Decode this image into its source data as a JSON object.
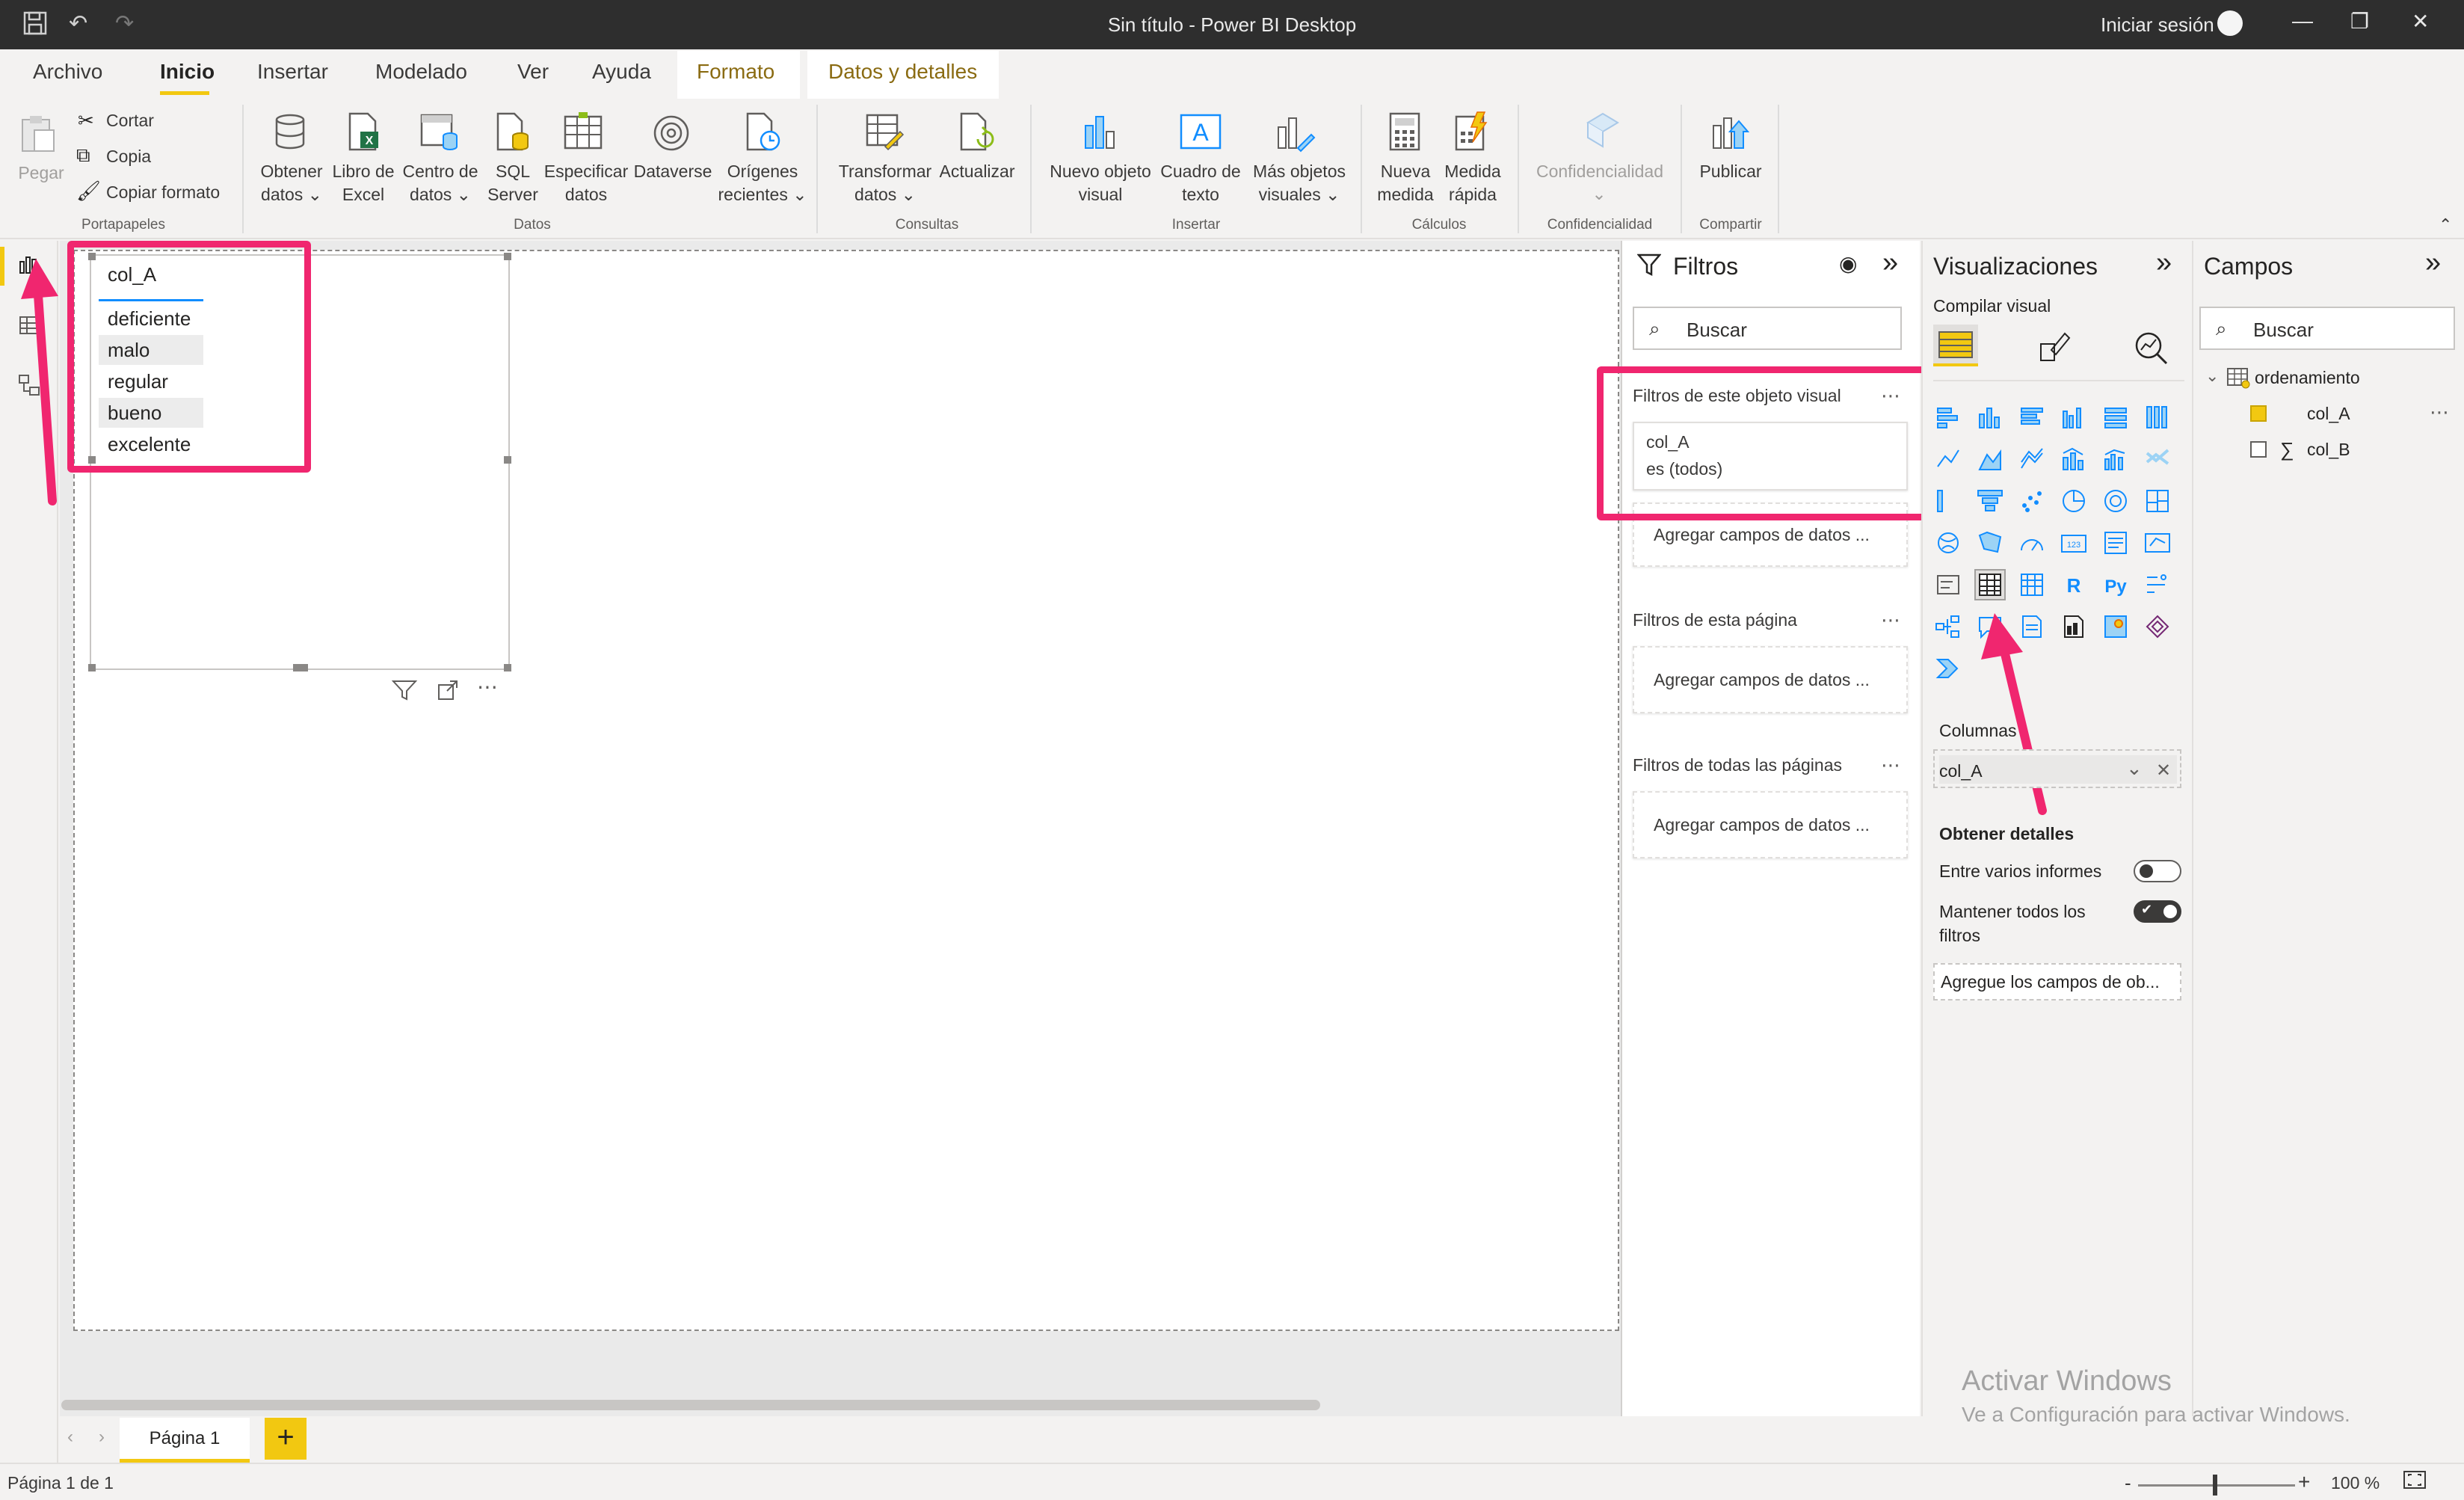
{
  "window": {
    "title": "Sin título - Power BI Desktop",
    "signin": "Iniciar sesión"
  },
  "menu": {
    "tabs": [
      "Archivo",
      "Inicio",
      "Insertar",
      "Modelado",
      "Ver",
      "Ayuda"
    ],
    "context_tabs": [
      "Formato",
      "Datos y detalles"
    ],
    "active": "Inicio"
  },
  "ribbon": {
    "portapapeles": {
      "paste": "Pegar",
      "cut": "Cortar",
      "copy": "Copia",
      "copy_format": "Copiar formato",
      "group": "Portapapeles"
    },
    "datos": {
      "get_data": [
        "Obtener",
        "datos"
      ],
      "excel": [
        "Libro de",
        "Excel"
      ],
      "datahub": [
        "Centro de",
        "datos"
      ],
      "sql": [
        "SQL",
        "Server"
      ],
      "enter_data": [
        "Especificar",
        "datos"
      ],
      "dataverse": "Dataverse",
      "recent": [
        "Orígenes",
        "recientes"
      ],
      "group": "Datos"
    },
    "consultas": {
      "transform": [
        "Transformar",
        "datos"
      ],
      "refresh": "Actualizar",
      "group": "Consultas"
    },
    "insertar": {
      "new_visual": [
        "Nuevo objeto",
        "visual"
      ],
      "textbox": [
        "Cuadro de",
        "texto"
      ],
      "more_visuals": [
        "Más objetos",
        "visuales"
      ],
      "group": "Insertar"
    },
    "calculos": {
      "new_measure": [
        "Nueva",
        "medida"
      ],
      "quick_measure": [
        "Medida",
        "rápida"
      ],
      "group": "Cálculos"
    },
    "confidencialidad": {
      "sensitivity": "Confidencialidad",
      "group": "Confidencialidad"
    },
    "compartir": {
      "publish": "Publicar",
      "group": "Compartir"
    }
  },
  "slicer": {
    "header": "col_A",
    "items": [
      "deficiente",
      "malo",
      "regular",
      "bueno",
      "excelente"
    ]
  },
  "filters": {
    "title": "Filtros",
    "search_placeholder": "Buscar",
    "visual_section": "Filtros de este objeto visual",
    "card_field": "col_A",
    "card_value": "es (todos)",
    "add_fields": "Agregar campos de datos ...",
    "page_section": "Filtros de esta página",
    "all_pages_section": "Filtros de todas las páginas"
  },
  "visualizations": {
    "title": "Visualizaciones",
    "build_visual": "Compilar visual",
    "columns_label": "Columnas",
    "column_field": "col_A",
    "drillthrough": "Obtener detalles",
    "cross_report": "Entre varios informes",
    "keep_filters": [
      "Mantener todos los",
      "filtros"
    ],
    "add_drill_fields": "Agregue los campos de ob..."
  },
  "fields": {
    "title": "Campos",
    "search_placeholder": "Buscar",
    "table": "ordenamiento",
    "columns": [
      {
        "name": "col_A",
        "checked": true
      },
      {
        "name": "col_B",
        "checked": false
      }
    ]
  },
  "pages": {
    "tab": "Página 1"
  },
  "status": {
    "page_info": "Página 1 de 1",
    "zoom": "100 %"
  },
  "watermark": {
    "line1": "Activar Windows",
    "line2": "Ve a Configuración para activar Windows."
  },
  "colors": {
    "accent": "#f2c811",
    "highlight": "#f0266f",
    "titlebar": "#2e2e2e"
  }
}
